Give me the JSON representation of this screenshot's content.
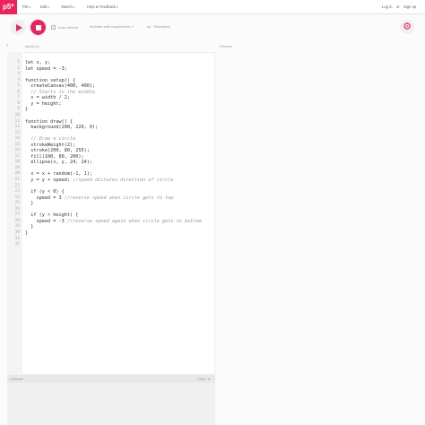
{
  "nav": {
    "logo": "p5*",
    "menus": [
      "File",
      "Edit",
      "Sketch",
      "Help & Feedback"
    ],
    "login": "Log in",
    "or": "or",
    "signup": "Sign up"
  },
  "toolbar": {
    "auto_refresh": "Auto-refresh",
    "project_name": "Animate with requirement 2",
    "by": "by",
    "author": "Shewsbop"
  },
  "editor": {
    "filename": "sketch.js",
    "lines": [
      "let x, y;",
      "let speed = -3;",
      "",
      "function setup() {",
      "  createCanvas(400, 400);",
      "  // Starts in the middle",
      "  x = width / 2;",
      "  y = height;",
      "}",
      "",
      "function draw() {",
      "  background(200, 220, 0);",
      "",
      "  // Draw a circle",
      "  strokeWeight(2);",
      "  stroke(200, 80, 255);",
      "  fill(100, 80, 200);",
      "  ellipse(x, y, 24, 24);",
      "",
      "  x = x + random(-1, 1);",
      "  y = y + speed; //speed dictates direction of circle",
      "",
      "  if (y < 0) {",
      "    speed = 3 //reverse speed when circle gets to top",
      "  }",
      "",
      "  if (y > height) {",
      "    speed = -3 //reverse speed again when circle gets to bottom",
      "  }",
      "}",
      "",
      ""
    ]
  },
  "preview": {
    "label": "Preview"
  },
  "console": {
    "label": "Console",
    "clear": "Clear"
  },
  "colors": {
    "accent": "#ed225d"
  },
  "icons": {
    "gear": "gear-icon",
    "play": "play-icon",
    "stop": "stop-icon"
  }
}
